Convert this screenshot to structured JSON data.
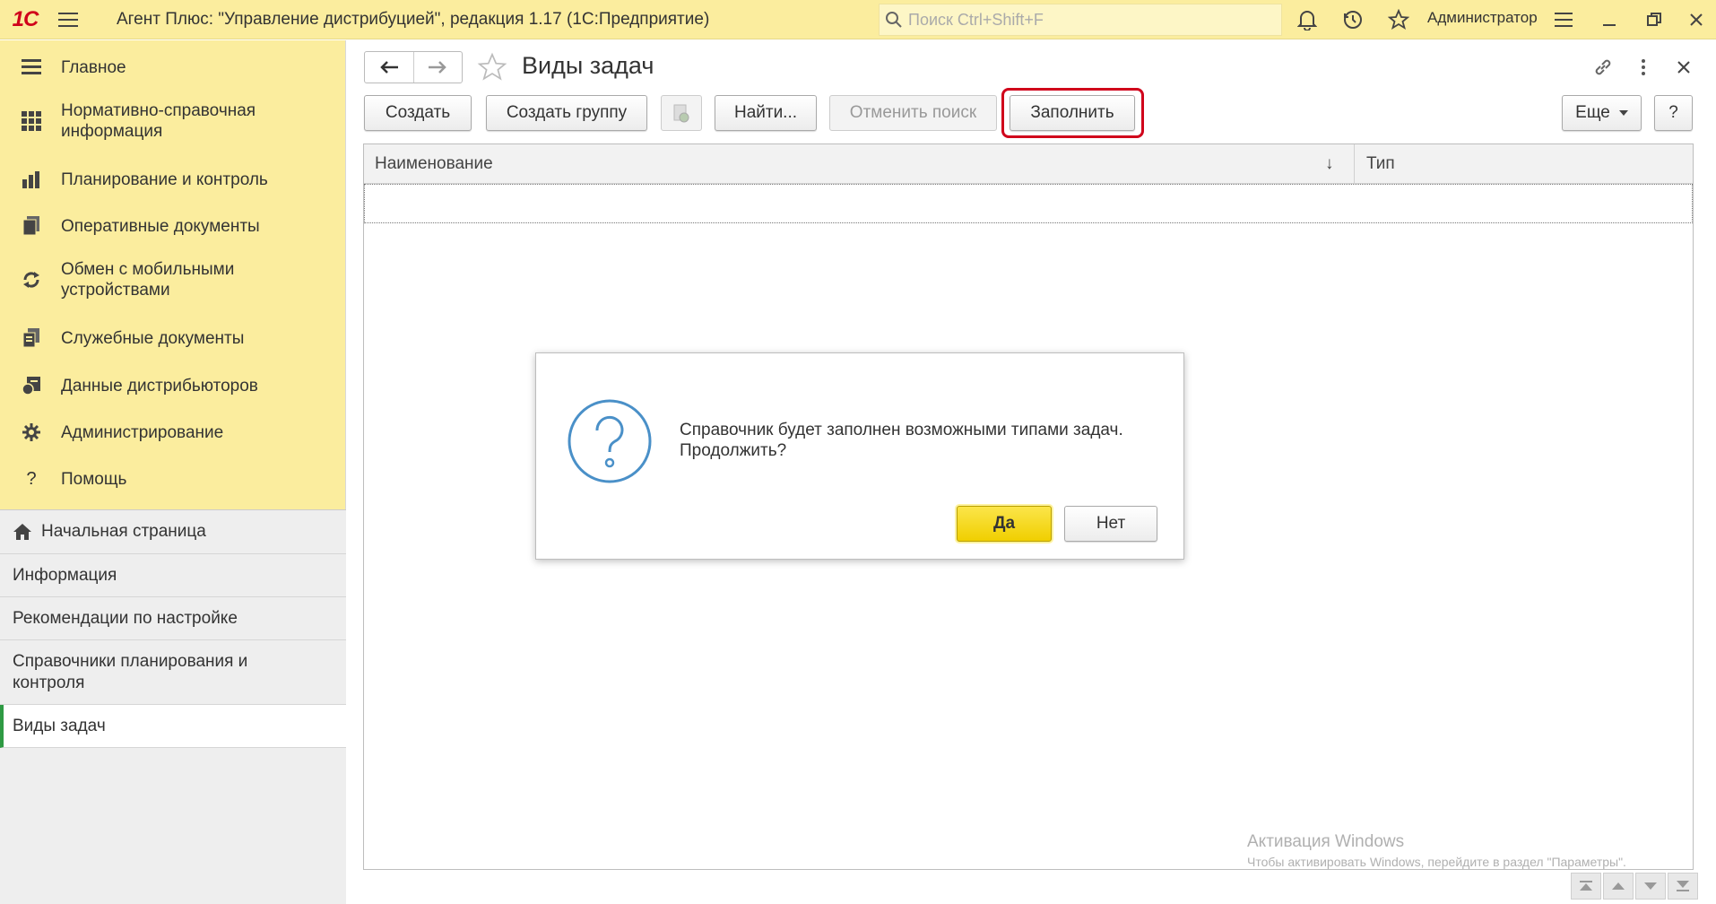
{
  "app": {
    "logo": "1С",
    "title": "Агент Плюс: \"Управление дистрибуцией\", редакция 1.17  (1С:Предприятие)",
    "search_placeholder": "Поиск Ctrl+Shift+F",
    "user": "Администратор"
  },
  "sidebar": {
    "sections": [
      {
        "label": "Главное",
        "icon": "menu-lines-icon"
      },
      {
        "label": "Нормативно-справочная информация",
        "icon": "grid-icon"
      },
      {
        "label": "Планирование и контроль",
        "icon": "bar-chart-icon"
      },
      {
        "label": "Оперативные документы",
        "icon": "documents-icon"
      },
      {
        "label": "Обмен с мобильными устройствами",
        "icon": "sync-icon"
      },
      {
        "label": "Служебные документы",
        "icon": "service-documents-icon"
      },
      {
        "label": "Данные дистрибьюторов",
        "icon": "distributor-data-icon"
      },
      {
        "label": "Администрирование",
        "icon": "gear-icon"
      },
      {
        "label": "Помощь",
        "icon": "question-icon"
      }
    ],
    "open_items": [
      {
        "label": "Начальная страница"
      },
      {
        "label": "Информация"
      },
      {
        "label": "Рекомендации по настройке"
      },
      {
        "label": "Справочники планирования и контроля"
      },
      {
        "label": "Виды задач"
      }
    ]
  },
  "page": {
    "title": "Виды задач"
  },
  "toolbar": {
    "create": "Создать",
    "create_group": "Создать группу",
    "find": "Найти...",
    "cancel_search": "Отменить поиск",
    "fill": "Заполнить",
    "more": "Еще",
    "help": "?"
  },
  "table": {
    "columns": [
      "Наименование",
      "Тип"
    ],
    "sort_indicator": "↓",
    "rows": []
  },
  "dialog": {
    "message": "Справочник будет заполнен возможными типами задач. Продолжить?",
    "yes": "Да",
    "no": "Нет"
  },
  "watermark": {
    "line1": "Активация Windows",
    "line2": "Чтобы активировать Windows, перейдите в раздел \"Параметры\"."
  },
  "colors": {
    "accent_yellow": "#fbed9e",
    "highlight_red": "#d0021b",
    "active_marker_green": "#2e9a43",
    "dialog_icon_blue": "#4a90c8"
  }
}
